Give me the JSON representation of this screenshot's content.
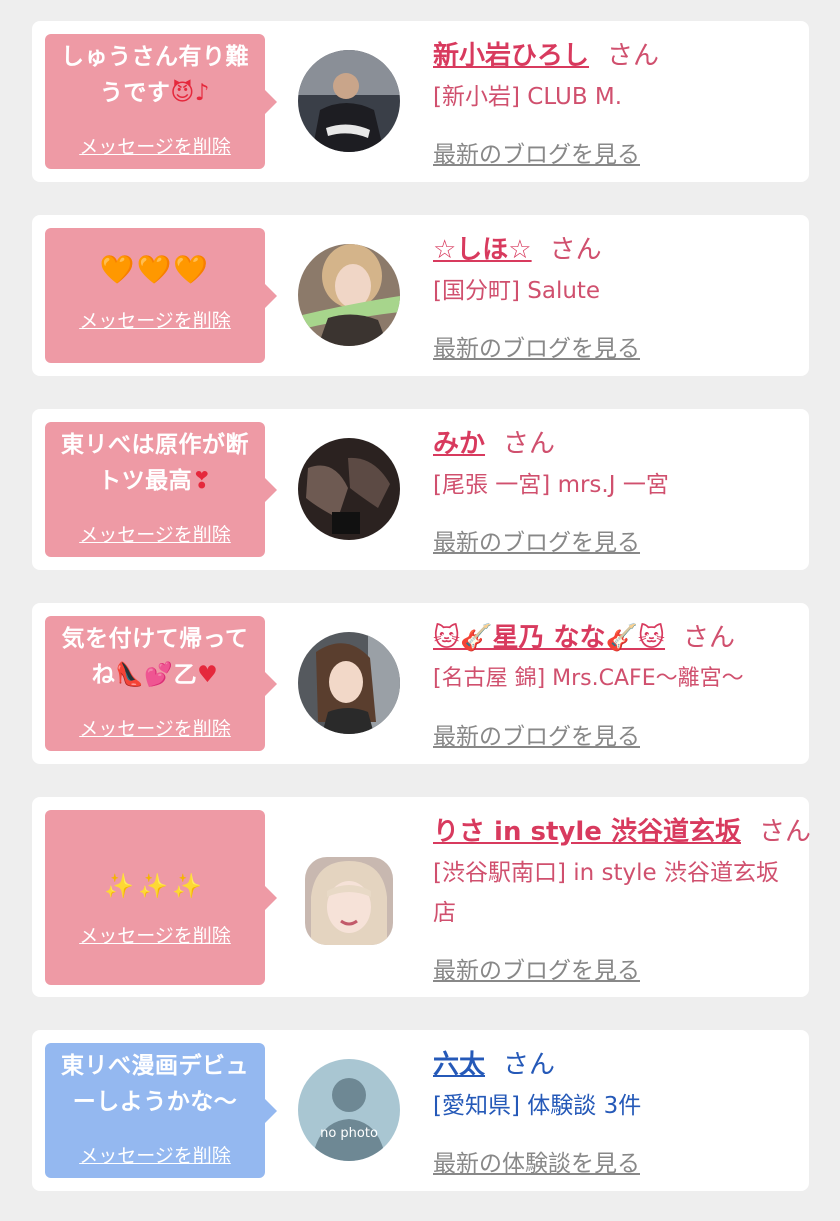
{
  "common": {
    "delete_label": "メッセージを削除",
    "honorific": "さん"
  },
  "messages": [
    {
      "bubble_text": "しゅうさん有り難うです",
      "bubble_emoji": "😈♪",
      "name": "新小岩ひろし",
      "shop": "[新小岩] CLUB M.",
      "link": "最新のブログを見る"
    },
    {
      "bubble_emoji": "🧡🧡🧡",
      "name": "☆しほ☆",
      "shop": "[国分町] Salute",
      "link": "最新のブログを見る"
    },
    {
      "bubble_text": "東リべは原作が断トツ最高",
      "bubble_emoji": "❣",
      "name": "みか",
      "shop": "[尾張 一宮] mrs.J 一宮",
      "link": "最新のブログを見る"
    },
    {
      "bubble_text_line1": "気を付けて帰って",
      "bubble_text_line2": "ね",
      "bubble_emoji_a": "👠💕",
      "bubble_text_line2b": "乙",
      "bubble_emoji_b": "♥",
      "name": "🐱🎸星乃 なな🎸🐱",
      "shop": "[名古屋 錦] Mrs.CAFE〜離宮〜",
      "link": "最新のブログを見る"
    },
    {
      "bubble_emoji": "✨✨✨",
      "name": "りさ in style 渋谷道玄坂",
      "shop": "[渋谷駅南口] in style 渋谷道玄坂店",
      "link": "最新のブログを見る"
    },
    {
      "bubble_text": "東リべ漫画デビューしようかな〜",
      "name": "六太",
      "shop": "[愛知県] 体験談 3件",
      "link": "最新の体験談を見る",
      "avatar_label": "no photo"
    }
  ]
}
